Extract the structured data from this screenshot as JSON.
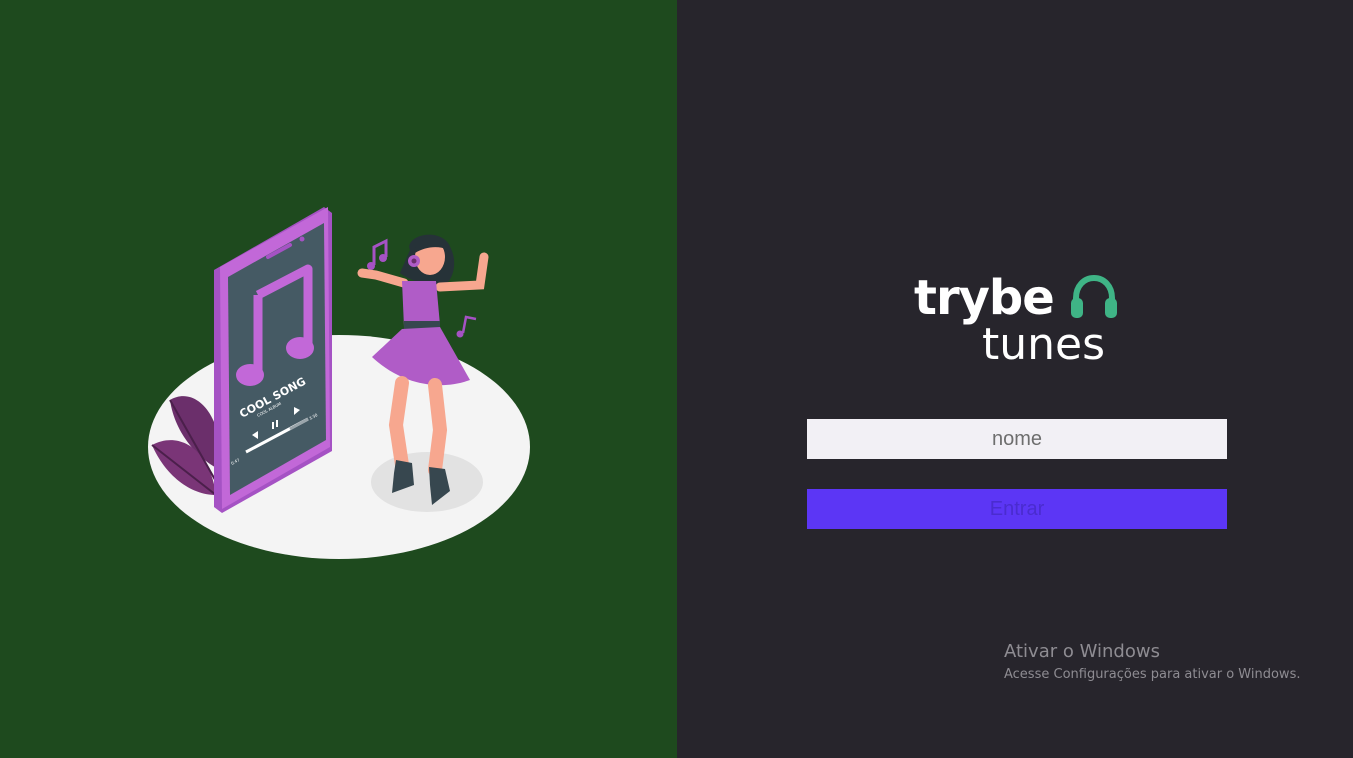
{
  "login": {
    "logo_text_top": "trybe",
    "logo_text_bottom": "tunes",
    "name_placeholder": "nome",
    "enter_button": "Entrar"
  },
  "illustration": {
    "song_title": "COOL SONG",
    "album": "COOL ALBUM",
    "time_elapsed": "0:47",
    "time_total": "3:30"
  },
  "windows_activation": {
    "title": "Ativar o Windows",
    "subtitle": "Acesse Configurações para ativar o Windows."
  },
  "colors": {
    "left_background": "#1e4a1e",
    "right_background": "#27252c",
    "accent_button": "#5c36f5",
    "headphone_icon": "#3fb486"
  }
}
